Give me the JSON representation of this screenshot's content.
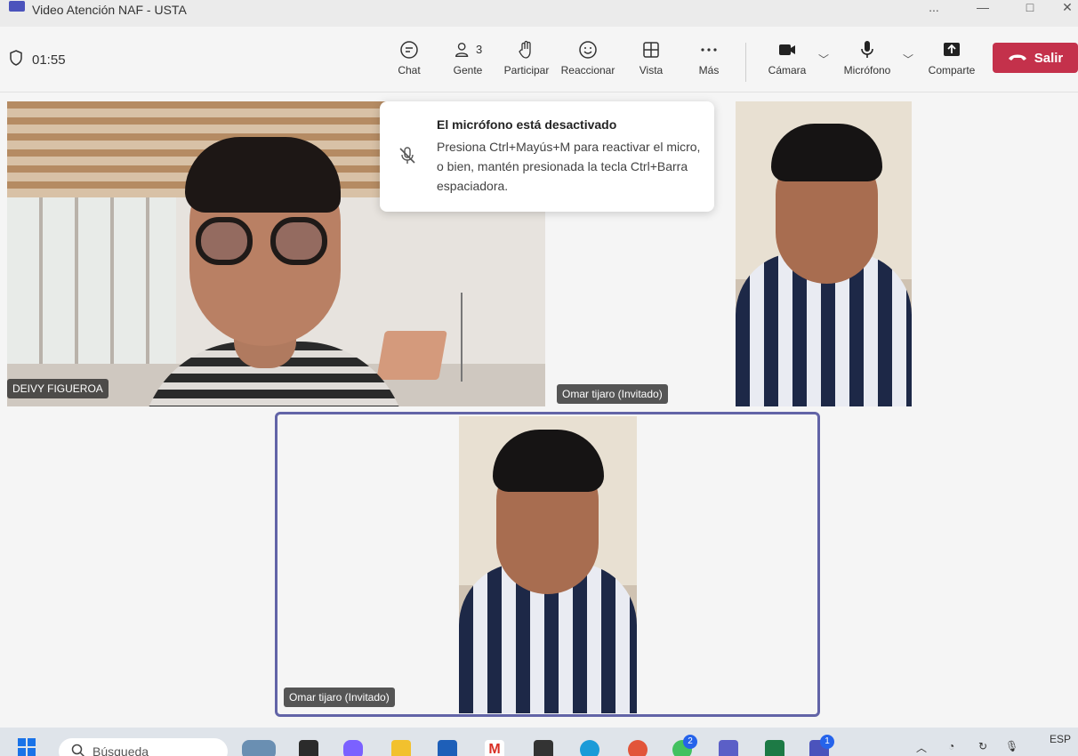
{
  "window": {
    "title": "Video Atención NAF - USTA",
    "controls": [
      "...",
      "—",
      "□",
      "✕"
    ]
  },
  "toolbar": {
    "timer": "01:55",
    "chat": "Chat",
    "people": "Gente",
    "people_count": "3",
    "raise": "Participar",
    "react": "Reaccionar",
    "view": "Vista",
    "more": "Más",
    "camera": "Cámara",
    "mic": "Micrófono",
    "share": "Comparte",
    "leave": "Salir"
  },
  "toast": {
    "title": "El micrófono está desactivado",
    "body": "Presiona Ctrl+Mayús+M para reactivar el micro, o bien, mantén presionada la tecla Ctrl+Barra espaciadora."
  },
  "participants": [
    {
      "name": "DEIVY FIGUEROA"
    },
    {
      "name": "Omar tijaro (Invitado)"
    },
    {
      "name": "Omar tijaro (Invitado)"
    }
  ],
  "taskbar": {
    "search_placeholder": "Búsqueda",
    "whatsapp_badge": "2",
    "teams_badge": "1",
    "lang": "ESP"
  },
  "colors": {
    "accent": "#6264a7",
    "leave": "#c4314b",
    "taskbar": "#dfe4ea"
  }
}
